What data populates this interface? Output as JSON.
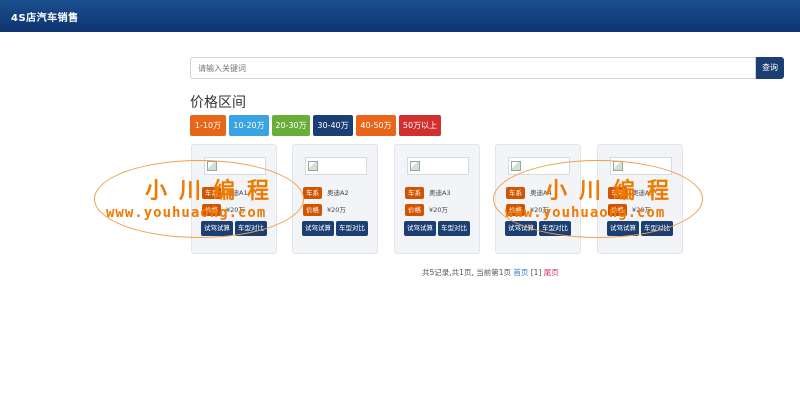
{
  "header": {
    "title": "4S店汽车销售"
  },
  "search": {
    "placeholder": "请输入关键词",
    "button_label": "查询"
  },
  "price_filter": {
    "title": "价格区间",
    "options": [
      {
        "label": "1-10万",
        "color": "#e8661a"
      },
      {
        "label": "10-20万",
        "color": "#3aa3e3"
      },
      {
        "label": "20-30万",
        "color": "#6aae3a"
      },
      {
        "label": "30-40万",
        "color": "#1b3f73"
      },
      {
        "label": "40-50万",
        "color": "#e8661a"
      },
      {
        "label": "50万以上",
        "color": "#d0302e"
      }
    ]
  },
  "cards": [
    {
      "series_tag": "车系",
      "series": "奥迪A1",
      "price_tag": "价格",
      "price": "¥20万",
      "action1": "试驾试算",
      "action2": "车型对比"
    },
    {
      "series_tag": "车系",
      "series": "奥迪A2",
      "price_tag": "价格",
      "price": "¥20万",
      "action1": "试驾试算",
      "action2": "车型对比"
    },
    {
      "series_tag": "车系",
      "series": "奥迪A3",
      "price_tag": "价格",
      "price": "¥20万",
      "action1": "试驾试算",
      "action2": "车型对比"
    },
    {
      "series_tag": "车系",
      "series": "奥迪A4",
      "price_tag": "价格",
      "price": "¥20万",
      "action1": "试驾试算",
      "action2": "车型对比"
    },
    {
      "series_tag": "车系",
      "series": "奥迪A5",
      "price_tag": "价格",
      "price": "¥20万",
      "action1": "试驾试算",
      "action2": "车型对比"
    }
  ],
  "pagination": {
    "summary": "共5记录,共1页, 当前第1页",
    "first": "首页",
    "current": "[1]",
    "last": "尾页"
  },
  "watermark": {
    "text1": "小川编程",
    "text2": "www.youhuaong.com"
  },
  "colors": {
    "brand": "#0d3470",
    "tag": "#d35400",
    "action": "#1b3f73",
    "watermark": "#f07a00"
  }
}
